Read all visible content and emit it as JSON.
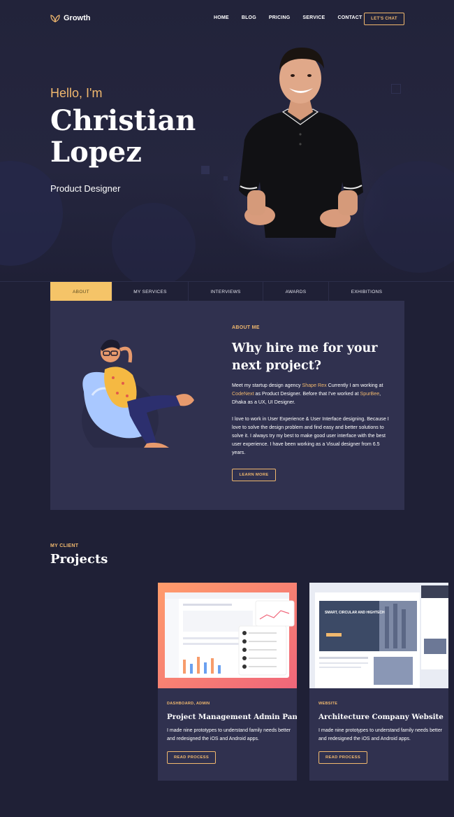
{
  "brand": {
    "name": "Growth",
    "accent": "#f0b86e",
    "background": "#1f2036",
    "card": "#30314f"
  },
  "nav": {
    "items": [
      "HOME",
      "BLOG",
      "PRICING",
      "SERVICE",
      "CONTACT"
    ],
    "cta": "LET'S CHAT"
  },
  "hero": {
    "greeting": "Hello, I'm",
    "first_name": "Christian",
    "last_name": "Lopez",
    "role": "Product Designer"
  },
  "tabs": {
    "items": [
      "ABOUT",
      "MY SERVICES",
      "INTERVIEWS",
      "AWARDS",
      "EXHIBITIONS"
    ],
    "active": "ABOUT"
  },
  "about": {
    "kicker": "ABOUT ME",
    "title": "Why hire me for your next project?",
    "p1_a": "Meet my startup design agency ",
    "p1_link1": "Shape Rex",
    "p1_b": " Currently I am working at ",
    "p1_link2": "CodeNext",
    "p1_c": " as Product Designer. Before that I've worked at ",
    "p1_link3": "SpurBee",
    "p1_d": ", Dhaka as a UX, UI Designer.",
    "p2": "I love to work in User Experience & User Interface designing. Because I love to solve the design problem and find easy and better solutions to solve it. I always try my best to make good user interface with the best user experience. I have been working as a Visual designer from 6.5 years.",
    "button": "LEARN MORE"
  },
  "projects": {
    "kicker": "MY CLIENT",
    "title": "Projects",
    "items": [
      {
        "tag": "DASHBOARD, ADMIN",
        "title": "Project Management Admin Panel",
        "desc": "I made nine prototypes to understand family needs better and redesigned the iOS and Android apps.",
        "button": "READ PROCESS"
      },
      {
        "tag": "WEBSITE",
        "title": "Architecture Company Website",
        "desc": "I made nine prototypes to understand family needs better and redesigned the iOS and Android apps.",
        "button": "READ PROCESS",
        "thumb_heading": "SMART, CIRCULAR AND HIGHTECH"
      }
    ]
  }
}
